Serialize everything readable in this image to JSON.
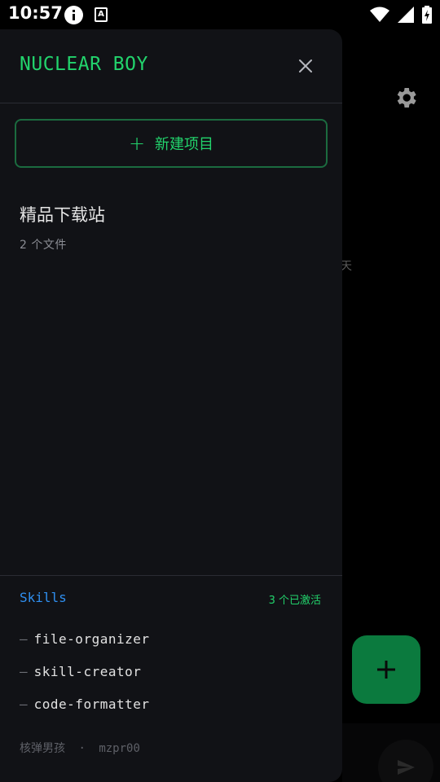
{
  "status_bar": {
    "time": "10:57",
    "a_label": "A"
  },
  "background": {
    "partial_text": "天",
    "fab_label": "+",
    "icons": [
      "gear-icon",
      "send-icon"
    ]
  },
  "drawer": {
    "title": "NUCLEAR BOY",
    "new_project_label": "新建项目",
    "new_project_plus": "+",
    "projects": [
      {
        "name": "精品下载站",
        "meta": "2 个文件"
      }
    ],
    "skills": {
      "title": "Skills",
      "count_label": "3 个已激活",
      "items": [
        {
          "dash": "—",
          "name": "file-organizer"
        },
        {
          "dash": "—",
          "name": "skill-creator"
        },
        {
          "dash": "—",
          "name": "code-formatter"
        }
      ]
    },
    "footer": {
      "name": "核弹男孩",
      "sep": "·",
      "handle": "mzpr00"
    }
  },
  "colors": {
    "accent_green": "#22d36c",
    "skills_blue": "#2f8ff0",
    "drawer_bg": "#111216",
    "fab_green": "#0b7a3e"
  }
}
